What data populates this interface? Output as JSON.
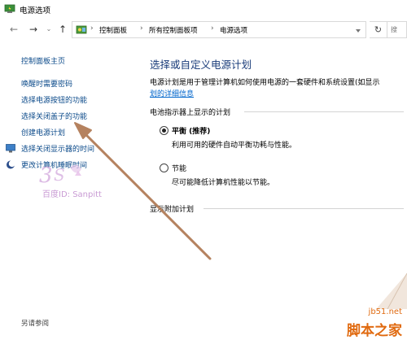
{
  "window": {
    "title": "电源选项"
  },
  "address": {
    "crumbs": [
      "控制面板",
      "所有控制面板项",
      "电源选项"
    ],
    "search_placeholder": "搜"
  },
  "sidebar": {
    "home": "控制面板主页",
    "items": [
      {
        "label": "唤醒时需要密码",
        "icon": ""
      },
      {
        "label": "选择电源按钮的功能",
        "icon": ""
      },
      {
        "label": "选择关闭盖子的功能",
        "icon": ""
      },
      {
        "label": "创建电源计划",
        "icon": ""
      },
      {
        "label": "选择关闭显示器的时间",
        "icon": "display-icon"
      },
      {
        "label": "更改计算机睡眠时间",
        "icon": "moon-icon"
      }
    ],
    "see_also": "另请参阅"
  },
  "main": {
    "heading": "选择或自定义电源计划",
    "description": "电源计划是用于管理计算机如何使用电源的一套硬件和系统设置(如显示",
    "more_link": "划的详细信息",
    "battery_group_label": "电池指示器上显示的计划",
    "plans": [
      {
        "name": "平衡 (推荐)",
        "description": "利用可用的硬件自动平衡功耗与性能。",
        "checked": true
      },
      {
        "name": "节能",
        "description": "尽可能降低计算机性能以节能。",
        "checked": false
      }
    ],
    "additional_label": "显示附加计划"
  },
  "watermarks": {
    "baidu": "百度ID: Sanpitt",
    "site": "jb51.net",
    "brand": "脚本之家"
  },
  "colors": {
    "link": "#0b4a8a",
    "heading": "#1a3c7a",
    "annotation_arrow": "#b5825f",
    "brand_orange": "#e06a10"
  }
}
